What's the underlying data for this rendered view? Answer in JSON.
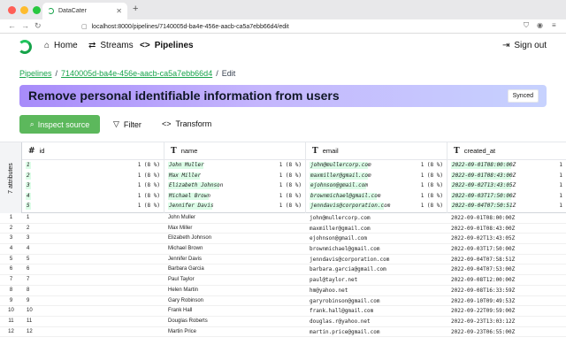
{
  "browser": {
    "tab_title": "DataCater",
    "url": "localhost:8000/pipelines/7140005d-ba4e-456e-aacb-ca5a7ebb66d4/edit"
  },
  "header": {
    "nav": [
      {
        "label": "Home",
        "icon": "home-icon"
      },
      {
        "label": "Streams",
        "icon": "streams-icon"
      },
      {
        "label": "Pipelines",
        "icon": "code-icon"
      }
    ],
    "signout_label": "Sign out"
  },
  "breadcrumb": {
    "root": "Pipelines",
    "pipeline_id": "7140005d-ba4e-456e-aacb-ca5a7ebb66d4",
    "current": "Edit"
  },
  "pipeline": {
    "title": "Remove personal identifiable information from users",
    "status": "Synced"
  },
  "toolbar": {
    "inspect_label": "Inspect source",
    "filter_label": "Filter",
    "transform_label": "Transform"
  },
  "grid": {
    "attributes_label": "7 attributes",
    "columns": [
      {
        "name": "id",
        "icon": "#",
        "profile": [
          {
            "value": "1",
            "count": "1 (8 %)"
          },
          {
            "value": "2",
            "count": "1 (8 %)"
          },
          {
            "value": "3",
            "count": "1 (8 %)"
          },
          {
            "value": "4",
            "count": "1 (8 %)"
          },
          {
            "value": "5",
            "count": "1 (8 %)"
          }
        ]
      },
      {
        "name": "name",
        "icon": "T",
        "profile": [
          {
            "value": "John Muller",
            "count": "1 (8 %)"
          },
          {
            "value": "Max Miller",
            "count": "1 (8 %)"
          },
          {
            "value": "Elizabeth Johnson",
            "count": "1 (8 %)"
          },
          {
            "value": "Michael Brown",
            "count": "1 (8 %)"
          },
          {
            "value": "Jennifer Davis",
            "count": "1 (8 %)"
          }
        ]
      },
      {
        "name": "email",
        "icon": "T",
        "profile": [
          {
            "value": "john@mullercorp.com",
            "count": "1 (8 %)"
          },
          {
            "value": "maxmiller@gmail.com",
            "count": "1 (8 %)"
          },
          {
            "value": "ejohnson@gmail.com",
            "count": "1 (8 %)"
          },
          {
            "value": "brownmichael@gmail.com",
            "count": "1 (8 %)"
          },
          {
            "value": "jenndavis@corporation.com",
            "count": "1 (8 %)"
          }
        ]
      },
      {
        "name": "created_at",
        "icon": "T",
        "profile": [
          {
            "value": "2022-09-01T08:00:00Z",
            "count": "1"
          },
          {
            "value": "2022-09-01T08:43:00Z",
            "count": "1"
          },
          {
            "value": "2022-09-02T13:43:05Z",
            "count": "1"
          },
          {
            "value": "2022-09-03T17:50:00Z",
            "count": "1"
          },
          {
            "value": "2022-09-04T07:50:51Z",
            "count": "1"
          }
        ]
      }
    ],
    "rows": [
      [
        "1",
        "1",
        "John Muller",
        "john@mullercorp.com",
        "2022-09-01T08:00:00Z"
      ],
      [
        "2",
        "2",
        "Max Miller",
        "maxmiller@gmail.com",
        "2022-09-01T08:43:00Z"
      ],
      [
        "3",
        "3",
        "Elizabeth Johnson",
        "ejohnson@gmail.com",
        "2022-09-02T13:43:05Z"
      ],
      [
        "4",
        "4",
        "Michael Brown",
        "brownmichael@gmail.com",
        "2022-09-03T17:50:00Z"
      ],
      [
        "5",
        "5",
        "Jennifer Davis",
        "jenndavis@corporation.com",
        "2022-09-04T07:58:51Z"
      ],
      [
        "6",
        "6",
        "Barbara Garcia",
        "barbara.garcia@gmail.com",
        "2022-09-04T07:53:00Z"
      ],
      [
        "7",
        "7",
        "Paul Taylor",
        "paul@taylor.net",
        "2022-09-08T12:00:00Z"
      ],
      [
        "8",
        "8",
        "Helen Martin",
        "hm@yahoo.net",
        "2022-09-08T16:33:59Z"
      ],
      [
        "9",
        "9",
        "Gary Robinson",
        "garyrobinson@gmail.com",
        "2022-09-10T09:49:53Z"
      ],
      [
        "10",
        "10",
        "Frank Hall",
        "frank.hall@gmail.com",
        "2022-09-22T09:59:00Z"
      ],
      [
        "11",
        "11",
        "Douglas Roberts",
        "douglas.r@yahoo.net",
        "2022-09-23T13:03:12Z"
      ],
      [
        "12",
        "12",
        "Martin Price",
        "martin.price@gmail.com",
        "2022-09-23T06:55:00Z"
      ]
    ]
  },
  "colors": {
    "accent": "#16a34a",
    "inspect_button": "#5cb85c",
    "banner_start": "#a78bfa",
    "banner_end": "#c7d2fe"
  }
}
